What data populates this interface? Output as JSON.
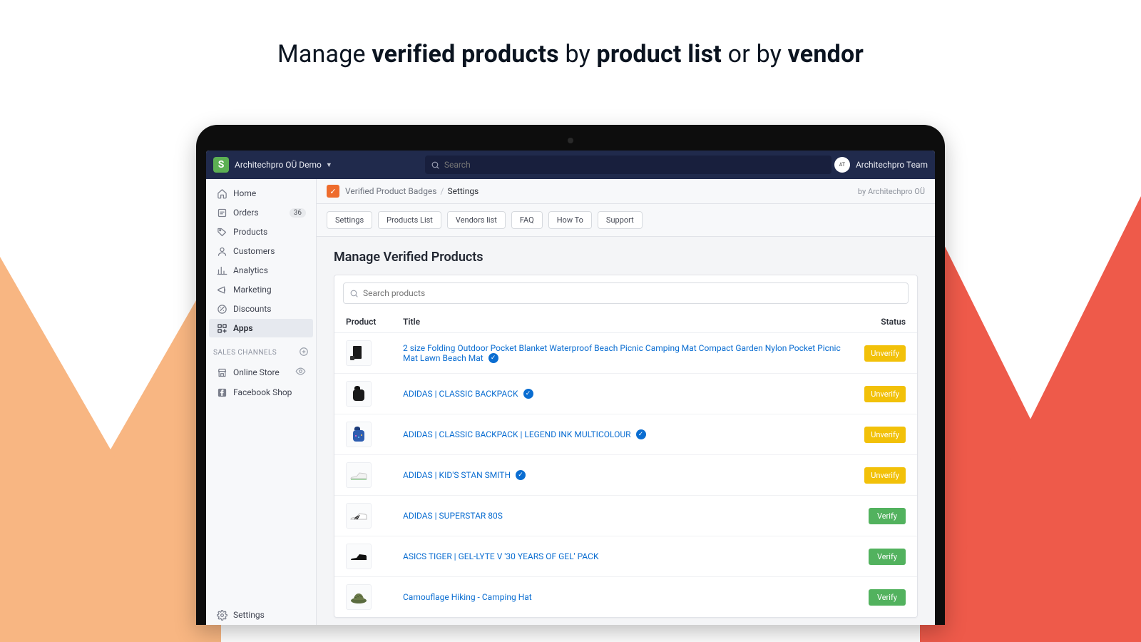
{
  "hero": {
    "prefix": "Manage ",
    "b1": "verified products",
    "mid1": " by ",
    "b2": "product list",
    "mid2": " or by ",
    "b3": "vendor"
  },
  "topbar": {
    "logo_letter": "S",
    "store_name": "Architechpro OÜ Demo",
    "search_placeholder": "Search",
    "user_name": "Architechpro Team"
  },
  "sidebar": {
    "items": [
      {
        "label": "Home",
        "icon": "home"
      },
      {
        "label": "Orders",
        "icon": "orders",
        "badge": "36"
      },
      {
        "label": "Products",
        "icon": "tag"
      },
      {
        "label": "Customers",
        "icon": "user"
      },
      {
        "label": "Analytics",
        "icon": "analytics"
      },
      {
        "label": "Marketing",
        "icon": "mega"
      },
      {
        "label": "Discounts",
        "icon": "discount"
      },
      {
        "label": "Apps",
        "icon": "apps",
        "active": true
      }
    ],
    "section_label": "SALES CHANNELS",
    "channels": [
      {
        "label": "Online Store",
        "icon": "store",
        "eye": true
      },
      {
        "label": "Facebook Shop",
        "icon": "fb"
      }
    ],
    "settings_label": "Settings"
  },
  "breadcrumbs": {
    "app_name": "Verified Product Badges",
    "current": "Settings",
    "byline_prefix": "by ",
    "byline_vendor": "Architechpro OÜ"
  },
  "tabs": [
    "Settings",
    "Products List",
    "Vendors list",
    "FAQ",
    "How To",
    "Support"
  ],
  "page_title": "Manage Verified Products",
  "product_search_placeholder": "Search products",
  "columns": {
    "product": "Product",
    "title": "Title",
    "status": "Status"
  },
  "labels": {
    "unverify": "Unverify",
    "verify": "Verify"
  },
  "products": [
    {
      "title": "2 size Folding Outdoor Pocket Blanket Waterproof Beach Picnic Camping Mat Compact Garden Nylon Pocket Picnic Mat Lawn Beach Mat",
      "verified": true,
      "action": "unverify",
      "thumb": "mat"
    },
    {
      "title": "ADIDAS | CLASSIC BACKPACK",
      "verified": true,
      "action": "unverify",
      "thumb": "backpack_black"
    },
    {
      "title": "ADIDAS | CLASSIC BACKPACK | LEGEND INK MULTICOLOUR",
      "verified": true,
      "action": "unverify",
      "thumb": "backpack_blue"
    },
    {
      "title": "ADIDAS | KID'S STAN SMITH",
      "verified": true,
      "action": "unverify",
      "thumb": "shoe_white"
    },
    {
      "title": "ADIDAS | SUPERSTAR 80S",
      "verified": false,
      "action": "verify",
      "thumb": "shoe_stripe"
    },
    {
      "title": "ASICS TIGER | GEL-LYTE V '30 YEARS OF GEL' PACK",
      "verified": false,
      "action": "verify",
      "thumb": "shoe_black"
    },
    {
      "title": "Camouflage Hiking - Camping Hat",
      "verified": false,
      "action": "verify",
      "thumb": "hat"
    }
  ]
}
